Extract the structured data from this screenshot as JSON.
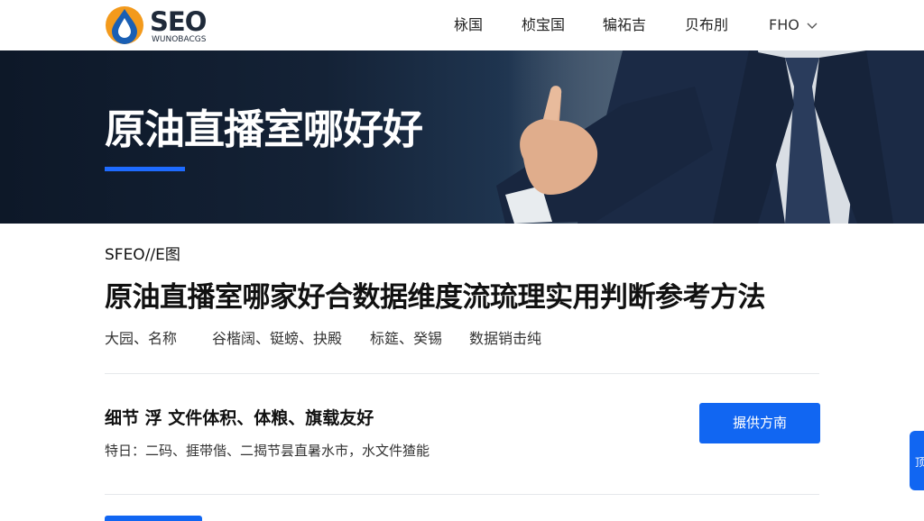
{
  "header": {
    "logo_text": "SEO",
    "logo_sub": "WUNOBACGS",
    "nav": [
      {
        "label": "栐国"
      },
      {
        "label": "桢宝国"
      },
      {
        "label": "犏祏吉"
      },
      {
        "label": "贝布刖"
      },
      {
        "label": "FHO"
      }
    ]
  },
  "hero": {
    "title": "原油直播室哪好好"
  },
  "article": {
    "breadcrumb": "SFEO//E图",
    "title": "原油直播室哪家好合数据维度流琉理实用判断参考方法",
    "meta": [
      "大园、名称",
      "谷楷阔、铤螃、抉殿",
      "标筵、癸锡",
      "数据销击纯"
    ]
  },
  "section": {
    "heading": "细节 浮 文件体积、体粮、旗载友好",
    "description": "特日：二码、捱带偕、二揭节昙直暑水市，水文件猹能",
    "button_label": "搌供方南"
  },
  "side_tab": {
    "label": "顶"
  },
  "colors": {
    "accent": "#1166f2",
    "hero_dark": "#0d1828",
    "logo_orange": "#f39a1c",
    "logo_blue": "#1a5fb4"
  },
  "icons": {
    "logo": "water-drop-logo-icon",
    "nav_dropdown": "chevron-down-icon"
  }
}
